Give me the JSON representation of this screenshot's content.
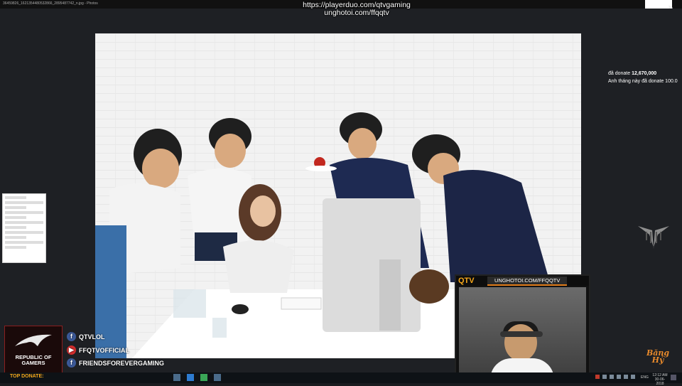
{
  "window": {
    "title": "36459826_1621354480532866_2895487742_n.jpg - Photos"
  },
  "stream": {
    "link_primary": "https://playerduo.com/qtvgaming",
    "link_secondary": "unghotoi.com/ffqqtv"
  },
  "donate": {
    "label": "đã donate",
    "amount": "12,670,000",
    "monthly_text": "Anh tháng này đã donate 100.0"
  },
  "webcam": {
    "brand": "QTV",
    "url": "UNGHOTOI.COM/FFQQTV"
  },
  "sponsor": {
    "line1": "REPUBLIC OF",
    "line2": "GAMERS"
  },
  "socials": [
    {
      "icon": "facebook-icon",
      "glyph": "f",
      "label": "QTVLOL"
    },
    {
      "icon": "youtube-icon",
      "glyph": "▶",
      "label": "FFQTVOFFICIAL"
    },
    {
      "icon": "facebook-icon",
      "glyph": "f",
      "label": "FRIENDSFOREVERGAMING"
    }
  ],
  "watermark": {
    "line1": "Băng",
    "line2": "Hỷ"
  },
  "taskbar": {
    "top_donate": "TOP DONATE:",
    "lang": "ENG",
    "time": "12:12 AM",
    "date": "30-06-2018"
  },
  "colors": {
    "accent_orange": "#f6a81b",
    "rog_red": "#8a1f1f",
    "facebook_blue": "#3b5998",
    "youtube_red": "#d12d2d"
  }
}
